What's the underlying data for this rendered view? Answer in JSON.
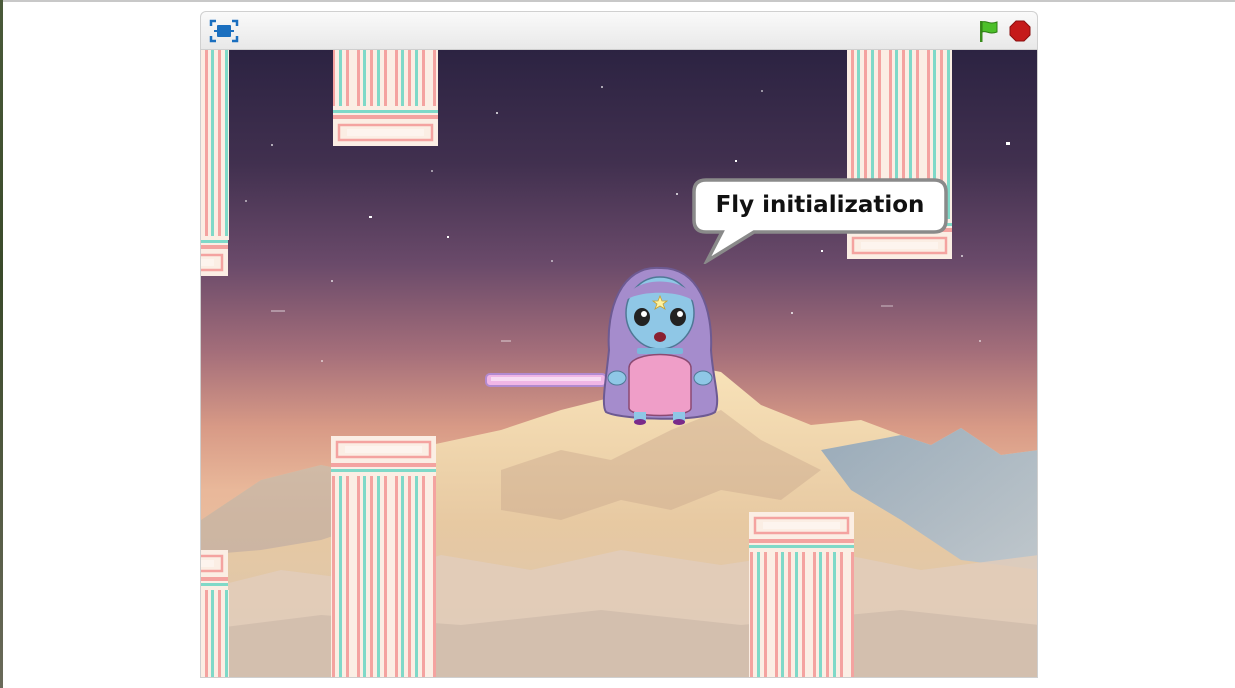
{
  "player": {
    "fullscreen_icon": "fullscreen-icon",
    "green_flag_icon": "green-flag-icon",
    "stop_icon": "stop-sign-icon"
  },
  "sprite": {
    "speech": "Fly initialization"
  },
  "colors": {
    "sky_top": "#2c2342",
    "sky_mid": "#6a4a6a",
    "sky_horizon": "#d89a86",
    "pillar_base": "#fbeee4",
    "pillar_teal": "#7fd9c8",
    "pillar_pink": "#f4a3a0",
    "flag_green": "#4cbf2a",
    "stop_red": "#c51a1a",
    "hood_purple": "#a58ccc",
    "skin_blue": "#8fc7e6",
    "dress_pink": "#ef9ec8"
  }
}
